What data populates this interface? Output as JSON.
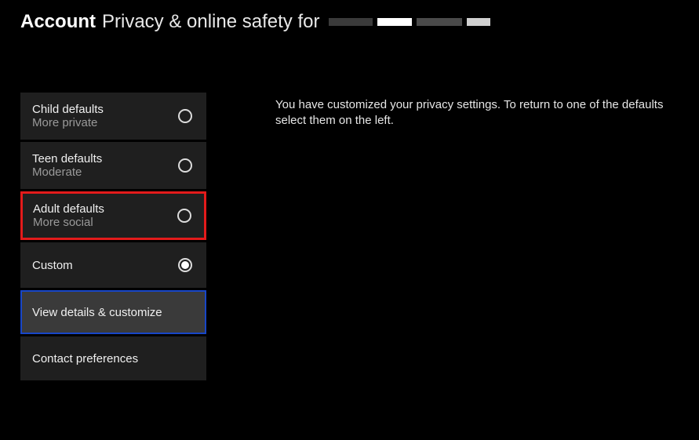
{
  "header": {
    "bold": "Account",
    "light": "Privacy & online safety for"
  },
  "options": {
    "child": {
      "label": "Child defaults",
      "sub": "More private"
    },
    "teen": {
      "label": "Teen defaults",
      "sub": "Moderate"
    },
    "adult": {
      "label": "Adult defaults",
      "sub": "More social"
    },
    "custom": {
      "label": "Custom"
    },
    "view": {
      "label": "View details & customize"
    },
    "contact": {
      "label": "Contact preferences"
    }
  },
  "description": "You have customized your privacy settings. To return to one of the defaults select them on the left."
}
